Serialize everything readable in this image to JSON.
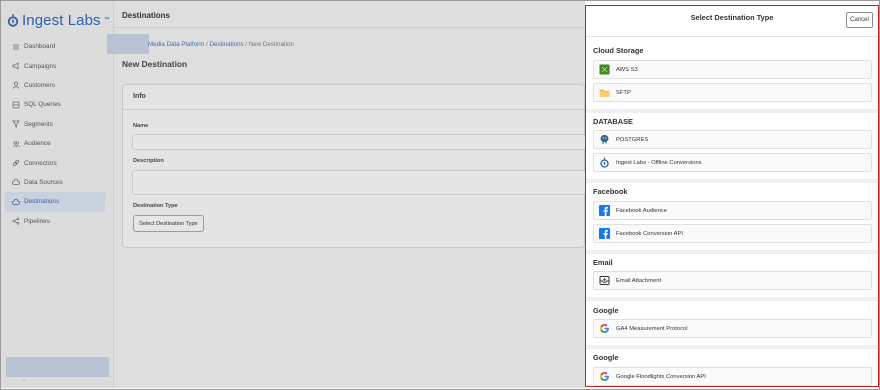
{
  "app": {
    "logo_text": "Ingest Labs",
    "logo_tm": "™"
  },
  "sidebar": {
    "items": [
      {
        "label": "Dashboard",
        "icon": "list-icon",
        "active": false
      },
      {
        "label": "Campaigns",
        "icon": "megaphone-icon",
        "active": false
      },
      {
        "label": "Customers",
        "icon": "user-icon",
        "active": false
      },
      {
        "label": "SQL Queries",
        "icon": "database-icon",
        "active": false
      },
      {
        "label": "Segments",
        "icon": "filter-icon",
        "active": false
      },
      {
        "label": "Audience",
        "icon": "group-icon",
        "active": false
      },
      {
        "label": "Connectors",
        "icon": "link-icon",
        "active": false
      },
      {
        "label": "Data Sources",
        "icon": "cloud-icon",
        "active": false
      },
      {
        "label": "Destinations",
        "icon": "cloud-icon",
        "active": true
      },
      {
        "label": "Pipelines",
        "icon": "share-icon",
        "active": false
      }
    ],
    "footer_mark": "«"
  },
  "main": {
    "topbar_title": "Destinations",
    "breadcrumb": {
      "first": "Media Data Platform",
      "sep1": " / ",
      "second": "Destinations",
      "sep2": " / ",
      "current": "New Destination"
    },
    "page_title": "New Destination",
    "card_title": "Info",
    "name_label": "Name",
    "description_label": "Description",
    "destination_type_label": "Destination Type",
    "destination_type_button": "Select Destination Type"
  },
  "panel": {
    "title": "Select Destination Type",
    "cancel_label": "Cancel",
    "sections": [
      {
        "title": "Cloud Storage",
        "options": [
          {
            "label": "AWS S3",
            "icon": "aws-s3-icon"
          },
          {
            "label": "SFTP",
            "icon": "folder-icon"
          }
        ]
      },
      {
        "title": "DATABASE",
        "options": [
          {
            "label": "POSTGRES",
            "icon": "postgres-icon"
          },
          {
            "label": "Ingest Labs - Offline Conversions",
            "icon": "ingest-labs-icon"
          }
        ]
      },
      {
        "title": "Facebook",
        "options": [
          {
            "label": "Facebook Audience",
            "icon": "facebook-icon"
          },
          {
            "label": "Facebook Conversion API",
            "icon": "facebook-icon"
          }
        ]
      },
      {
        "title": "Email",
        "options": [
          {
            "label": "Email Attachment",
            "icon": "email-icon"
          }
        ]
      },
      {
        "title": "Google",
        "options": [
          {
            "label": "GA4 Measurement Protocol",
            "icon": "google-icon"
          }
        ]
      },
      {
        "title": "Google",
        "options": [
          {
            "label": "Google Floodlights Conversion API",
            "icon": "google-icon"
          }
        ]
      }
    ]
  },
  "colors": {
    "accent": "#3d6fb4",
    "panel_border": "#b3262a",
    "facebook": "#1877f2",
    "aws": "#3f8624",
    "folder": "#f4b942"
  }
}
